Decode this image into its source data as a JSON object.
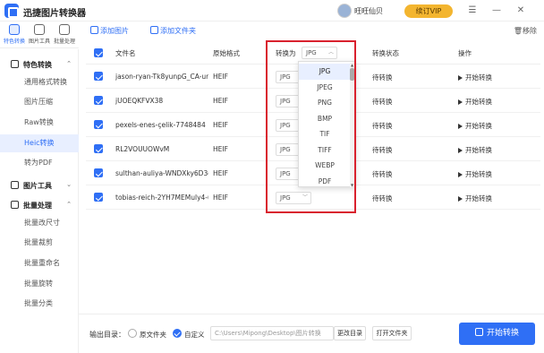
{
  "app": {
    "title": "迅捷图片转换器",
    "user_name": "旺旺仙贝",
    "vip_label": "续订VIP"
  },
  "window": {
    "menu": "☰",
    "minimize": "—",
    "close": "✕"
  },
  "rail": [
    {
      "label": "特色转换",
      "active": true
    },
    {
      "label": "图片工具",
      "active": false
    },
    {
      "label": "批量处理",
      "active": false
    }
  ],
  "sidebar": {
    "groups": [
      {
        "label": "特色转换",
        "chevron": "⌃"
      },
      {
        "label": "图片工具",
        "chevron": "⌄"
      },
      {
        "label": "批量处理",
        "chevron": "⌃"
      }
    ],
    "items": [
      "通用格式转换",
      "图片压缩",
      "Raw转换",
      "Heic转换",
      "转为PDF",
      "批量改尺寸",
      "批量裁剪",
      "批量重命名",
      "批量旋转",
      "批量分类"
    ]
  },
  "toolbar": {
    "add_image": "添加图片",
    "add_folder": "添加文件夹",
    "remove": "移除"
  },
  "table": {
    "headers": {
      "filename": "文件名",
      "original_format": "原始格式",
      "convert_to": "转换为",
      "status": "转换状态",
      "action": "操作"
    },
    "header_select_value": "JPG",
    "rows": [
      {
        "filename": "jason-ryan-Tk8yunpG_CA-uns...",
        "format": "HEIF",
        "target": "JPG",
        "status": "待转换",
        "action": "开始转换"
      },
      {
        "filename": "jUOEQKFVX38",
        "format": "HEIF",
        "target": "JPG",
        "status": "待转换",
        "action": "开始转换"
      },
      {
        "filename": "pexels-enes-çelik-7748484",
        "format": "HEIF",
        "target": "JPG",
        "status": "待转换",
        "action": "开始转换"
      },
      {
        "filename": "RL2VOUUOWvM",
        "format": "HEIF",
        "target": "JPG",
        "status": "待转换",
        "action": "开始转换"
      },
      {
        "filename": "sulthan-auliya-WNDXky6D3ds...",
        "format": "HEIF",
        "target": "JPG",
        "status": "待转换",
        "action": "开始转换"
      },
      {
        "filename": "tobias-reich-2YH7MEMuly4-u...",
        "format": "HEIF",
        "target": "JPG",
        "status": "待转换",
        "action": "开始转换"
      }
    ]
  },
  "dropdown": {
    "options": [
      "JPG",
      "JPEG",
      "PNG",
      "BMP",
      "TIF",
      "TIFF",
      "WEBP",
      "PDF"
    ],
    "selected": "JPG"
  },
  "footer": {
    "output_label": "输出目录：",
    "option_original": "原文件夹",
    "option_custom": "自定义",
    "path": "C:\\Users\\Mipong\\Desktop\\图片转换",
    "change_dir": "更改目录",
    "open_folder": "打开文件夹",
    "start": "开始转换"
  },
  "colors": {
    "accent": "#2f6ff5",
    "highlight": "#d9212e",
    "vip": "#f3b52f"
  }
}
